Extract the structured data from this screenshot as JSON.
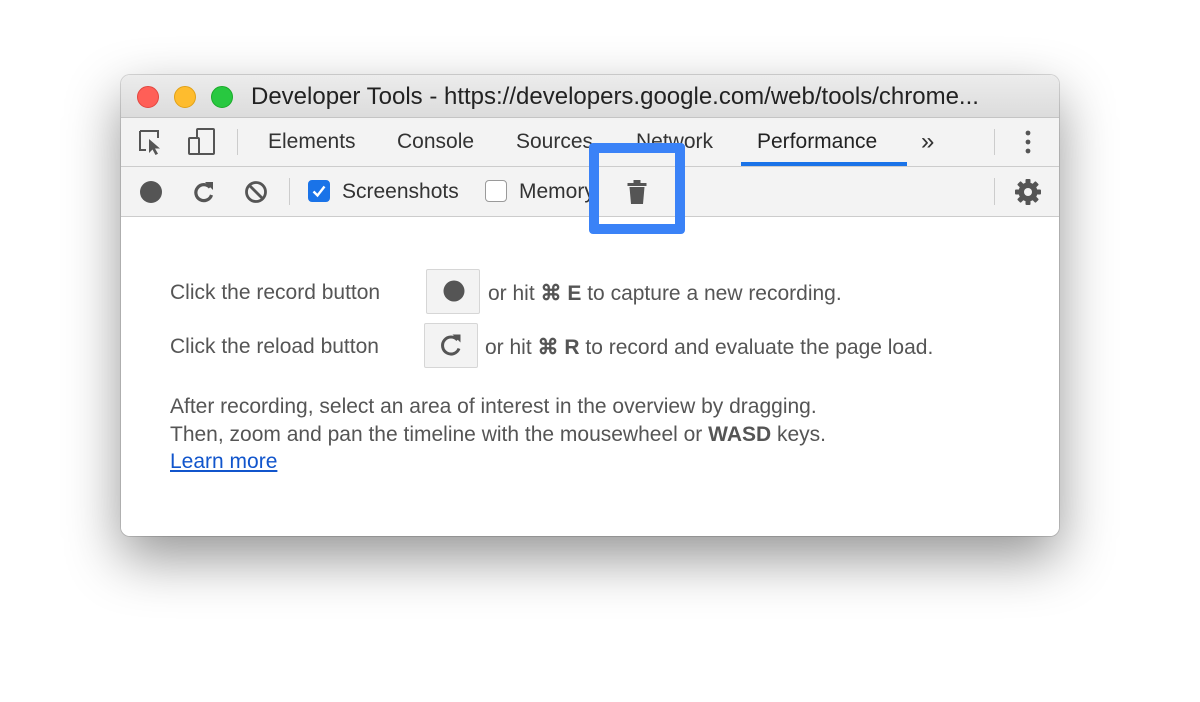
{
  "window": {
    "title": "Developer Tools - https://developers.google.com/web/tools/chrome..."
  },
  "tabs": {
    "items": [
      {
        "label": "Elements"
      },
      {
        "label": "Console"
      },
      {
        "label": "Sources"
      },
      {
        "label": "Network"
      },
      {
        "label": "Performance",
        "active": true
      }
    ],
    "more_label": "»"
  },
  "toolbar": {
    "screenshots_label": "Screenshots",
    "screenshots_checked": true,
    "memory_label": "Memory",
    "memory_checked": false
  },
  "content": {
    "record_pre": "Click the record button",
    "record_mid": "or hit",
    "record_key": "⌘ E",
    "record_post": "to capture a new recording.",
    "reload_pre": "Click the reload button",
    "reload_mid": "or hit",
    "reload_key": "⌘ R",
    "reload_post": "to record and evaluate the page load.",
    "after_line1": "After recording, select an area of interest in the overview by dragging.",
    "after_line2_pre": "Then, zoom and pan the timeline with the mousewheel or",
    "after_line2_key": "WASD",
    "after_line2_post": "keys.",
    "learn_more": "Learn more"
  },
  "colors": {
    "accent": "#1a73e8",
    "highlight": "#3a82f7",
    "link": "#1155cc"
  },
  "icons": [
    "inspect-element-icon",
    "device-toolbar-icon",
    "more-tabs-icon",
    "kebab-menu-icon",
    "record-icon",
    "reload-icon",
    "clear-icon",
    "trash-icon",
    "gear-icon",
    "checkmark-icon"
  ]
}
